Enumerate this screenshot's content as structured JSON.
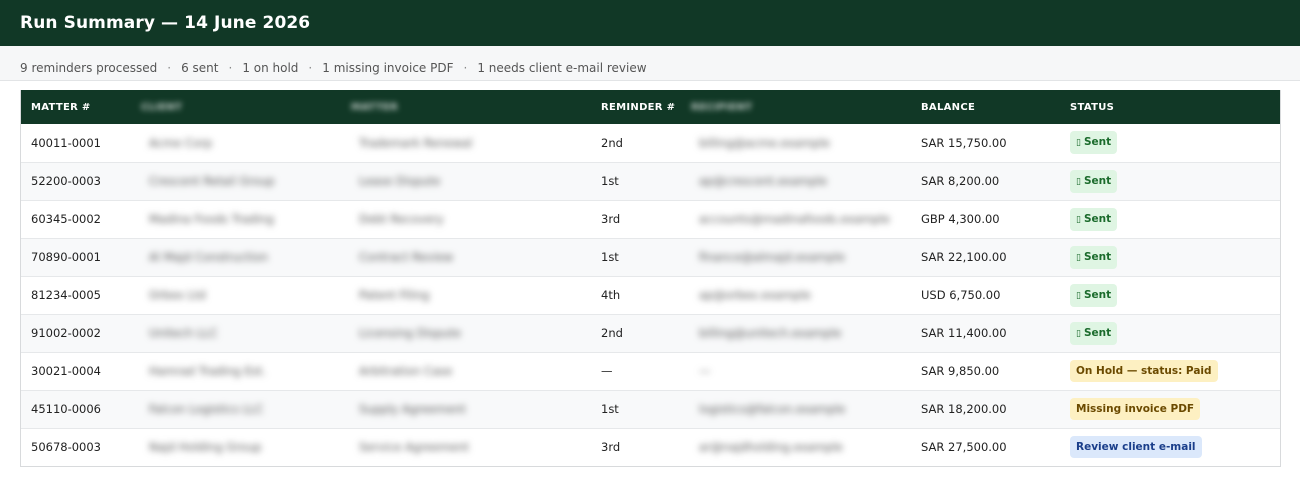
{
  "header": {
    "title": "Run Summary — 14 June 2026"
  },
  "summary": {
    "items": [
      "9 reminders processed",
      "6 sent",
      "1 on hold",
      "1 missing invoice PDF",
      "1 needs client e-mail review"
    ],
    "separator": "·"
  },
  "table": {
    "columns": {
      "matter": "MATTER #",
      "client": "CLIENT",
      "matter_name": "MATTER",
      "reminder": "REMINDER #",
      "recipient": "RECIPIENT",
      "balance": "BALANCE",
      "status": "STATUS"
    },
    "rows": [
      {
        "matter": "40011-0001",
        "client": "Acme Corp",
        "matter_name": "Trademark Renewal",
        "reminder": "2nd",
        "recipient": "billing@acme.example",
        "balance": "SAR 15,750.00",
        "status": "Sent",
        "status_type": "sent"
      },
      {
        "matter": "52200-0003",
        "client": "Crescent Retail Group",
        "matter_name": "Lease Dispute",
        "reminder": "1st",
        "recipient": "ap@crescent.example",
        "balance": "SAR 8,200.00",
        "status": "Sent",
        "status_type": "sent"
      },
      {
        "matter": "60345-0002",
        "client": "Madina Foods Trading",
        "matter_name": "Debt Recovery",
        "reminder": "3rd",
        "recipient": "accounts@madinafoods.example",
        "balance": "GBP 4,300.00",
        "status": "Sent",
        "status_type": "sent"
      },
      {
        "matter": "70890-0001",
        "client": "Al Majd Construction",
        "matter_name": "Contract Review",
        "reminder": "1st",
        "recipient": "finance@almajd.example",
        "balance": "SAR 22,100.00",
        "status": "Sent",
        "status_type": "sent"
      },
      {
        "matter": "81234-0005",
        "client": "Orbex Ltd",
        "matter_name": "Patent Filing",
        "reminder": "4th",
        "recipient": "ap@orbex.example",
        "balance": "USD 6,750.00",
        "status": "Sent",
        "status_type": "sent"
      },
      {
        "matter": "91002-0002",
        "client": "Unitech LLC",
        "matter_name": "Licensing Dispute",
        "reminder": "2nd",
        "recipient": "billing@unitech.example",
        "balance": "SAR 11,400.00",
        "status": "Sent",
        "status_type": "sent"
      },
      {
        "matter": "30021-0004",
        "client": "Hamrad Trading Est.",
        "matter_name": "Arbitration Case",
        "reminder": "—",
        "recipient": "—",
        "balance": "SAR 9,850.00",
        "status": "On Hold — status: Paid",
        "status_type": "hold"
      },
      {
        "matter": "45110-0006",
        "client": "Falcon Logistics LLC",
        "matter_name": "Supply Agreement",
        "reminder": "1st",
        "recipient": "logistics@falcon.example",
        "balance": "SAR 18,200.00",
        "status": "Missing invoice PDF",
        "status_type": "missing"
      },
      {
        "matter": "50678-0003",
        "client": "Najd Holding Group",
        "matter_name": "Service Agreement",
        "reminder": "3rd",
        "recipient": "ar@najdholding.example",
        "balance": "SAR 27,500.00",
        "status": "Review client e-mail",
        "status_type": "review"
      }
    ]
  },
  "colors": {
    "brand": "#113826",
    "sent_bg": "#dff5e3",
    "hold_bg": "#fdf0c2",
    "review_bg": "#dbe8fb"
  },
  "icons": {
    "sent": "check-icon"
  }
}
